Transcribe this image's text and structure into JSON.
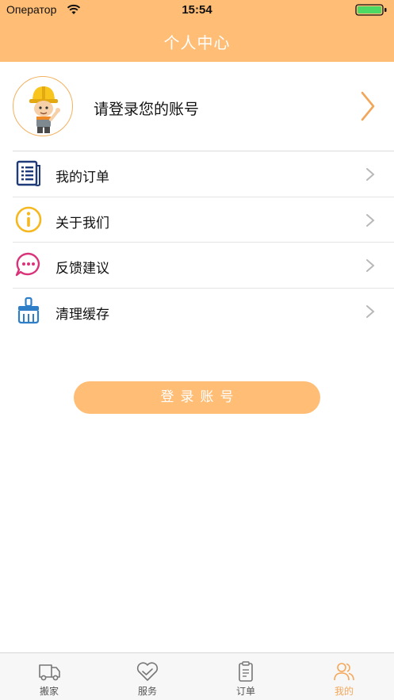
{
  "status_bar": {
    "carrier": "Оператор",
    "time": "15:54"
  },
  "nav": {
    "title": "个人中心"
  },
  "profile": {
    "login_prompt": "请登录您的账号"
  },
  "menu": [
    {
      "label": "我的订单",
      "icon": "order-list-icon"
    },
    {
      "label": "关于我们",
      "icon": "info-icon"
    },
    {
      "label": "反馈建议",
      "icon": "chat-bubble-icon"
    },
    {
      "label": "清理缓存",
      "icon": "broom-icon"
    }
  ],
  "login_button": {
    "label": "登录账号"
  },
  "tabs": [
    {
      "label": "搬家",
      "icon": "truck-icon",
      "active": false
    },
    {
      "label": "服务",
      "icon": "heart-check-icon",
      "active": false
    },
    {
      "label": "订单",
      "icon": "clipboard-icon",
      "active": false
    },
    {
      "label": "我的",
      "icon": "users-icon",
      "active": true
    }
  ],
  "colors": {
    "accent": "#FFBD75",
    "active_tab": "#F5A75A"
  }
}
